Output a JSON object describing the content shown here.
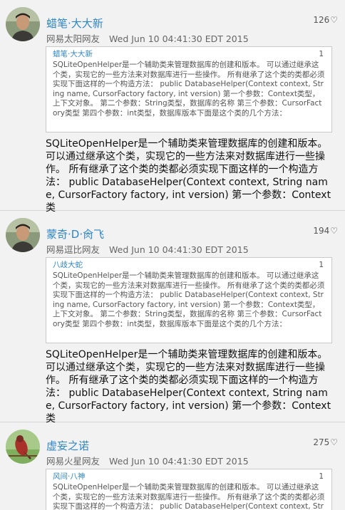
{
  "posts": [
    {
      "username": "蜡笔·大大新",
      "likes": "126",
      "source": "网易太阳网友",
      "timestamp": "Wed Jun 10 04:41:30 EDT 2015",
      "quote": {
        "user": "蜡笔·大大新",
        "floor": "1",
        "text": "SQLiteOpenHelper是一个辅助类来管理数据库的创建和版本。 可以通过继承这个类，实现它的一些方法来对数据库进行一些操作。 所有继承了这个类的类都必须实现下面这样的一个构造方法： public DatabaseHelper(Context context, String name, CursorFactory factory, int version) 第一个参数：Context类型，上下文对象。 第二个参数：String类型，数据库的名称 第三个参数：CursorFactory类型 第四个参数：int类型，数据库版本下面是这个类的几个方法："
      },
      "body": "SQLiteOpenHelper是一个辅助类来管理数据库的创建和版本。可以通过继承这个类，实现它的一些方法来对数据库进行一些操作。 所有继承了这个类的类都必须实现下面这样的一个构造方法： public DatabaseHelper(Context context, String name, CursorFactory factory, int version) 第一个参数：Context类"
    },
    {
      "username": "蒙奇·D·肏飞",
      "likes": "194",
      "source": "网易逗比网友",
      "timestamp": "Wed Jun 10 04:41:30 EDT 2015",
      "quote": {
        "user": "八歧大蛇",
        "floor": "1",
        "text": "SQLiteOpenHelper是一个辅助类来管理数据库的创建和版本。 可以通过继承这个类，实现它的一些方法来对数据库进行一些操作。 所有继承了这个类的类都必须实现下面这样的一个构造方法： public DatabaseHelper(Context context, String name, CursorFactory factory, int version) 第一个参数：Context类型，上下文对象。 第二个参数：String类型，数据库的名称 第三个参数：CursorFactory类型 第四个参数：int类型，数据库版本下面是这个类的几个方法："
      },
      "body": "SQLiteOpenHelper是一个辅助类来管理数据库的创建和版本。可以通过继承这个类，实现它的一些方法来对数据库进行一些操作。 所有继承了这个类的类都必须实现下面这样的一个构造方法： public DatabaseHelper(Context context, String name, CursorFactory factory, int version) 第一个参数：Context类"
    },
    {
      "username": "虚妄之诺",
      "likes": "275",
      "source": "网易火星网友",
      "timestamp": "Wed Jun 10 04:41:30 EDT 2015",
      "quote": {
        "user": "风间·八神",
        "floor": "1",
        "text": "SQLiteOpenHelper是一个辅助类来管理数据库的创建和版本。 可以通过继承这个类，实现它的一些方法来对数据库进行一些操作。 所有继承了这个类的类都必须实现下面这样的一个构造方法： public DatabaseHelper(Context context, String name, CursorFactory factory, int version) 第一个参数："
      }
    }
  ],
  "icons": {
    "like": "heart-icon",
    "avatar": "avatar-photo"
  },
  "colors": {
    "username": "#2f86c8",
    "background": "#f2f2f2",
    "quote_bg": "#ffffff"
  }
}
